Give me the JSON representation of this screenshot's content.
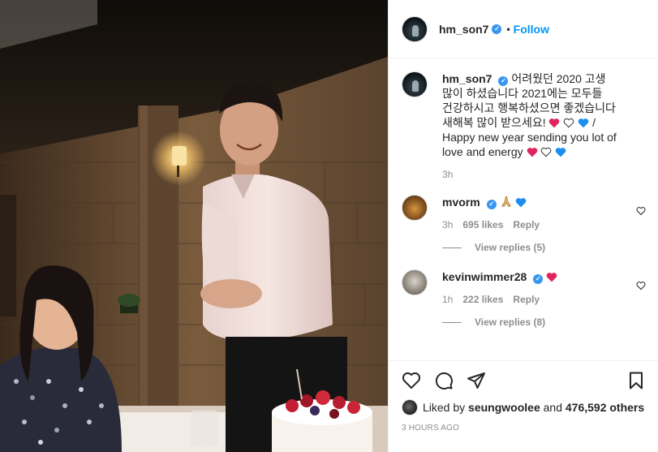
{
  "post": {
    "author": "hm_son7",
    "follow_label": "Follow",
    "separator": "•",
    "photo_alt": "Photo shared by hm_son7"
  },
  "caption": {
    "user": "hm_son7",
    "text_ko": "어려웠던 2020 고생 많이 하셨습니다 2021에는 모두들 건강하시고 행복하셨으면 좋겠습니다 새해복 많이 받으세요!",
    "text_en": "/ Happy new year sending you lot of love and energy",
    "time": "3h"
  },
  "comments": [
    {
      "user": "mvorm",
      "time": "3h",
      "likes": "695 likes",
      "reply_label": "Reply",
      "view_replies": "View replies (5)"
    },
    {
      "user": "kevinwimmer28",
      "time": "1h",
      "likes": "222 likes",
      "reply_label": "Reply",
      "view_replies": "View replies (8)"
    }
  ],
  "icons": {
    "like": "heart-outline-icon",
    "comment": "comment-bubble-icon",
    "share": "paper-plane-icon",
    "save": "bookmark-icon",
    "verified": "verified-badge-icon"
  },
  "likes_row": {
    "prefix": "Liked by",
    "user": "seungwoolee",
    "middle": "and",
    "count": "476,592 others"
  },
  "timestamp": "3 hours ago",
  "colors": {
    "accent": "#0095f6",
    "verified": "#3897f0",
    "heart_red": "#e0245e",
    "heart_blue": "#1d8ef0",
    "secondary_text": "#8e8e8e"
  }
}
